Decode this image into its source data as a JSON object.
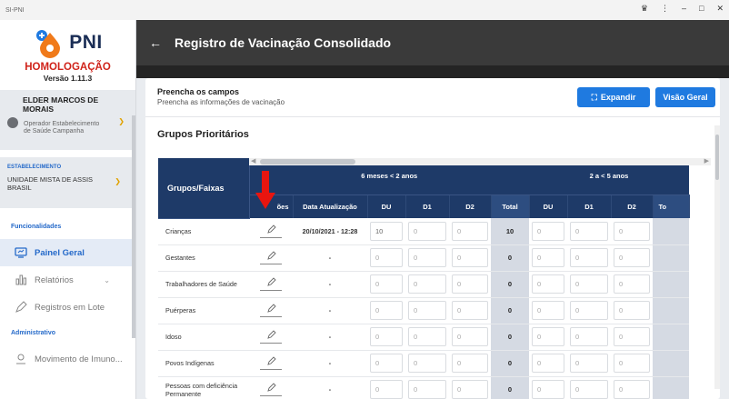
{
  "window": {
    "title": "SI-PNI"
  },
  "sidebar": {
    "logo_text": "PNI",
    "environment": "HOMOLOGAÇÃO",
    "version": "Versão 1.11.3",
    "user": {
      "name": "ELDER MARCOS DE MORAIS",
      "role": "Operador Estabelecimento de Saúde Campanha"
    },
    "establishment": {
      "label": "ESTABELECIMENTO",
      "name": "UNIDADE MISTA DE ASSIS BRASIL"
    },
    "section_functionalities": "Funcionalidades",
    "section_admin": "Administrativo",
    "items": [
      {
        "label": "Painel Geral",
        "icon": "dashboard-icon"
      },
      {
        "label": "Relatórios",
        "icon": "reports-icon"
      },
      {
        "label": "Registros em Lote",
        "icon": "batch-pen-icon"
      },
      {
        "label": "Movimento de Imuno...",
        "icon": "movement-icon"
      }
    ]
  },
  "header": {
    "title": "Registro de Vacinação Consolidado"
  },
  "form": {
    "title": "Preencha os campos",
    "subtitle": "Preencha as informações de vacinação",
    "expand_label": "Expandir",
    "overview_label": "Visão Geral",
    "section_title": "Grupos Prioritários"
  },
  "table": {
    "group_header": "Grupos/Faixas",
    "band_1": "6 meses < 2 anos",
    "band_2": "2 a < 5 anos",
    "col_edit": "ões",
    "col_date": "Data Atualização",
    "col_du": "DU",
    "col_d1": "D1",
    "col_d2": "D2",
    "col_total": "Total",
    "col_total_cut": "To",
    "rows": [
      {
        "group": "Crianças",
        "date": "20/10/2021 - 12:28",
        "du": "10",
        "d1": "0",
        "d2": "0",
        "total": "10",
        "du2": "0",
        "d12": "0",
        "d22": "0"
      },
      {
        "group": "Gestantes",
        "date": "-",
        "du": "0",
        "d1": "0",
        "d2": "0",
        "total": "0",
        "du2": "0",
        "d12": "0",
        "d22": "0"
      },
      {
        "group": "Trabalhadores de Saúde",
        "date": "-",
        "du": "0",
        "d1": "0",
        "d2": "0",
        "total": "0",
        "du2": "0",
        "d12": "0",
        "d22": "0"
      },
      {
        "group": "Puérperas",
        "date": "-",
        "du": "0",
        "d1": "0",
        "d2": "0",
        "total": "0",
        "du2": "0",
        "d12": "0",
        "d22": "0"
      },
      {
        "group": "Idoso",
        "date": "-",
        "du": "0",
        "d1": "0",
        "d2": "0",
        "total": "0",
        "du2": "0",
        "d12": "0",
        "d22": "0"
      },
      {
        "group": "Povos Indígenas",
        "date": "-",
        "du": "0",
        "d1": "0",
        "d2": "0",
        "total": "0",
        "du2": "0",
        "d12": "0",
        "d22": "0"
      },
      {
        "group": "Pessoas com deficiência Permanente",
        "date": "-",
        "du": "0",
        "d1": "0",
        "d2": "0",
        "total": "0",
        "du2": "0",
        "d12": "0",
        "d22": "0"
      }
    ]
  },
  "colors": {
    "accent": "#1f7ae0",
    "header_dark": "#3a3a3a",
    "table_header": "#1e3a68",
    "env_red": "#d0231a",
    "arrow_red": "#e8150f"
  }
}
